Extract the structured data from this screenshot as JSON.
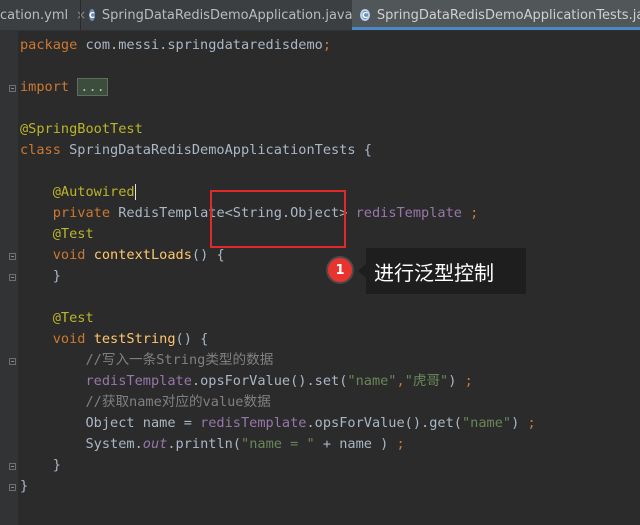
{
  "tabs": [
    {
      "label": "cation.yml",
      "icon": "yaml-file-icon"
    },
    {
      "label": "SpringDataRedisDemoApplication.java",
      "icon": "java-class-icon"
    },
    {
      "label": "SpringDataRedisDemoApplicationTests.java",
      "icon": "java-class-icon",
      "active": true
    }
  ],
  "tab_close": "×",
  "code": {
    "package_kw": "package",
    "package_name": " com.messi.springdataredisdemo",
    "semicolon": ";",
    "import_kw": "import",
    "import_folded": "...",
    "spring_boot_test": "@SpringBootTest",
    "class_kw": "class",
    "class_name": " SpringDataRedisDemoApplicationTests {",
    "autowired": "@Autowired",
    "private_kw": "private",
    "redis_template_type": " RedisTemplate<String.Object> ",
    "redis_template_field": "redisTemplate",
    "space_semicolon": " ;",
    "test_ann": "@Test",
    "void_kw": "void",
    "context_loads": "contextLoads",
    "empty_body": "() {",
    "close_brace": "}",
    "test_string": "testString",
    "comment1": "//写入一条String类型的数据",
    "line_set_a": ".opsForValue().set(",
    "str_name": "\"name\"",
    "comma": ",",
    "str_value": "\"虎哥\"",
    "paren_close": ")",
    "comment2": "//获取name对应的value数据",
    "object_name_eq": "Object name = ",
    "line_get_a": ".opsForValue().get(",
    "system": "System.",
    "out": "out",
    "println": ".println(",
    "str_name_eq": "\"name = \"",
    "plus_name": " + name ) "
  },
  "annotation": {
    "badge_number": "1",
    "callout_text": "进行泛型控制"
  },
  "colors": {
    "background": "#2b2b2b",
    "keyword": "#cc7832",
    "annotation": "#bbb529",
    "string": "#6a8759",
    "comment": "#808080",
    "method": "#ffc66d",
    "field": "#9876aa",
    "highlight_box": "#e02a2a"
  }
}
